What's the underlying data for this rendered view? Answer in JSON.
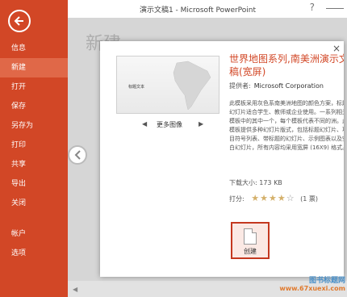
{
  "window": {
    "title": "演示文稿1 - Microsoft PowerPoint",
    "help": "?"
  },
  "sidebar": {
    "back_icon": "back-arrow-icon",
    "items": [
      {
        "label": "信息",
        "active": false
      },
      {
        "label": "新建",
        "active": true
      },
      {
        "label": "打开",
        "active": false
      },
      {
        "label": "保存",
        "active": false
      },
      {
        "label": "另存为",
        "active": false
      },
      {
        "label": "打印",
        "active": false
      },
      {
        "label": "共享",
        "active": false
      },
      {
        "label": "导出",
        "active": false
      },
      {
        "label": "关闭",
        "active": false
      },
      {
        "label": "帐户",
        "active": false
      },
      {
        "label": "选项",
        "active": false
      }
    ]
  },
  "main": {
    "heading": "新建"
  },
  "dialog": {
    "close": "×",
    "thumbnail_title": "标题文本",
    "nav_prev": "◀",
    "nav_label": "更多图像",
    "nav_next": "▶",
    "template_title": "世界地图系列,南美洲演示文稿(宽屏)",
    "provider_label": "提供者:",
    "provider_name": "Microsoft Corporation",
    "description": "此模板采用灰色系南美洲地图的颜色方案，标题幻灯片适合学生、教师或企业使用。一系列相关模板中的其中一个，每个模板代表不同的洲。此模板提供多种幻灯片版式，包括标题幻灯片、项目符号列表、带标题的幻灯片、示例图表以及空白幻灯片，所有内容均采用宽屏 (16X9) 格式。",
    "size_label": "下载大小:",
    "size_value": "173 KB",
    "rating_label": "打分:",
    "rating_value": 4,
    "rating_max": 5,
    "rating_count": "(1 票)",
    "create_label": "创建"
  },
  "watermark": {
    "line1": "图书标题网",
    "line2": "www.67xuexi.com"
  },
  "colors": {
    "accent": "#d24726",
    "active_item": "#e06848",
    "title_red": "#d24726",
    "star": "#d4b06a"
  }
}
